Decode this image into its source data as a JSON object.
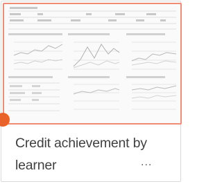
{
  "card": {
    "title": "Credit achievement by learner",
    "more_label": "...",
    "accent_color": "#f08c74",
    "status_color": "#e8622a"
  },
  "thumbnail": {
    "panels": [
      "table",
      "line-chart",
      "line-chart",
      "line-chart",
      "table",
      "line-chart",
      "line-chart"
    ]
  }
}
